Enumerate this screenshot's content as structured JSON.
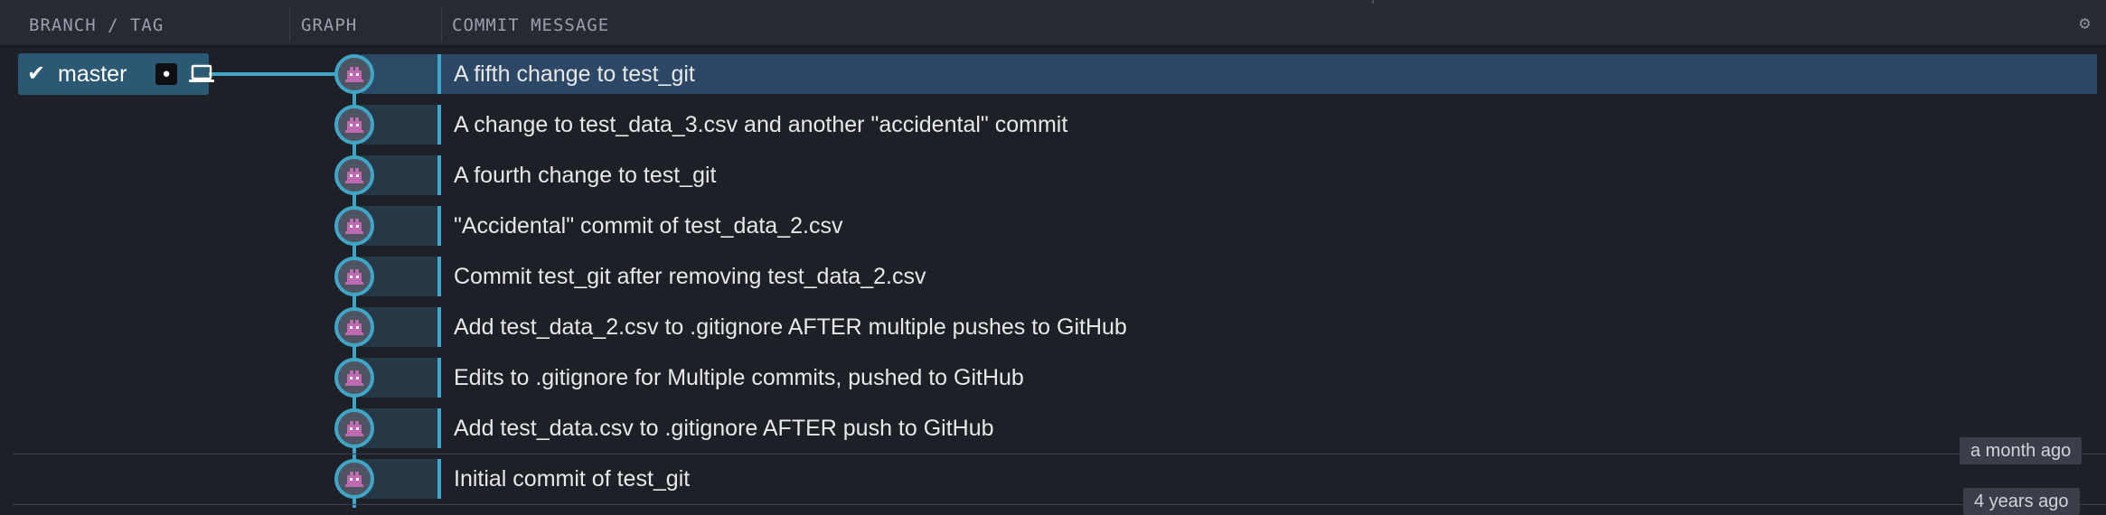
{
  "header": {
    "branch_tag": "BRANCH / TAG",
    "graph": "GRAPH",
    "commit_message": "COMMIT MESSAGE",
    "settings_icon": "gear-icon"
  },
  "branch": {
    "name": "master",
    "check_icon": "check-icon",
    "remote_icon": "github-icon",
    "local_icon": "laptop-icon"
  },
  "commits": [
    {
      "message": "A fifth change to test_git",
      "selected": true
    },
    {
      "message": "A change to test_data_3.csv and another \"accidental\" commit"
    },
    {
      "message": "A fourth change to test_git"
    },
    {
      "message": "\"Accidental\" commit of test_data_2.csv"
    },
    {
      "message": "Commit test_git after removing test_data_2.csv"
    },
    {
      "message": "Add test_data_2.csv to .gitignore AFTER multiple pushes to GitHub"
    },
    {
      "message": "Edits to .gitignore for Multiple commits, pushed to GitHub"
    },
    {
      "message": "Add test_data.csv to .gitignore AFTER push to GitHub"
    },
    {
      "message": "Initial commit of test_git"
    }
  ],
  "time_labels": {
    "recent": "a month ago",
    "old": "4 years ago"
  },
  "colors": {
    "accent": "#3fa6c8",
    "selected_row": "#2d4866",
    "branch_badge": "#2b5872",
    "background": "#1e2028"
  }
}
